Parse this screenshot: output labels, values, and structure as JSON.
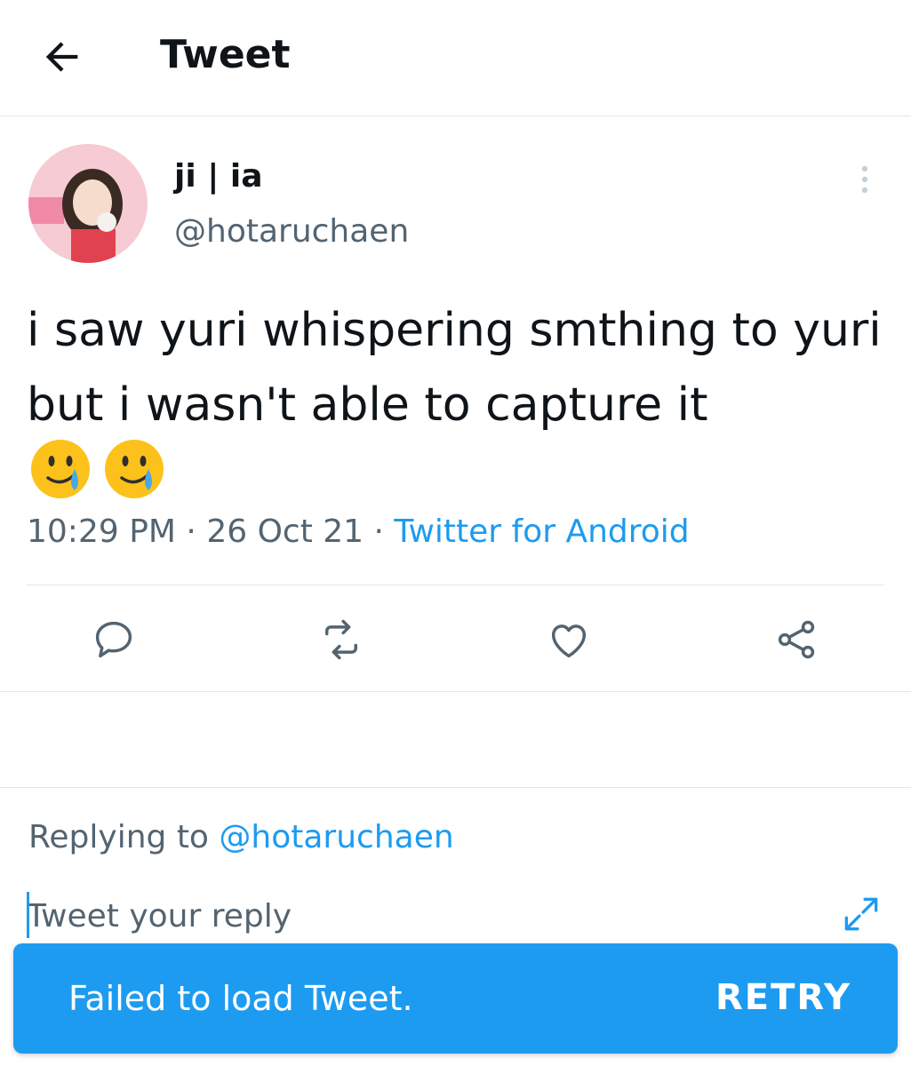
{
  "header": {
    "title": "Tweet",
    "back_icon": "arrow-left-icon"
  },
  "tweet": {
    "author": {
      "display_name": "ji | ia",
      "handle": "@hotaruchaen"
    },
    "text": "i saw yuri whispering smthing to yuri but i wasn't able to capture it",
    "emojis": [
      "smiling-face-with-tear-icon",
      "smiling-face-with-tear-icon"
    ],
    "time": "10:29 PM",
    "date": "26 Oct 21",
    "separator": " · ",
    "source": "Twitter for Android"
  },
  "actions": [
    "reply-icon",
    "retweet-icon",
    "like-icon",
    "share-icon"
  ],
  "reply": {
    "replying_prefix": "Replying to ",
    "replying_to": "@hotaruchaen",
    "placeholder": "Tweet your reply"
  },
  "snackbar": {
    "message": "Failed to load Tweet.",
    "action_label": "RETRY"
  },
  "colors": {
    "accent": "#1d9bf0",
    "secondary_text": "#536471",
    "divider": "#e1e8ed"
  }
}
